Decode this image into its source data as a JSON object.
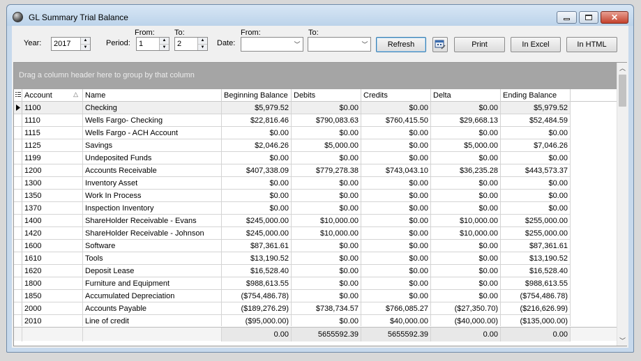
{
  "window": {
    "title": "GL Summary Trial Balance"
  },
  "toolbar": {
    "year_label": "Year:",
    "year_value": "2017",
    "period_label": "Period:",
    "period_from_label": "From:",
    "period_to_label": "To:",
    "period_from": "1",
    "period_to": "2",
    "date_label": "Date:",
    "date_from_label": "From:",
    "date_to_label": "To:",
    "date_from": "",
    "date_to": "",
    "refresh": "Refresh",
    "print": "Print",
    "in_excel": "In Excel",
    "in_html": "In HTML"
  },
  "grid": {
    "group_panel_text": "Drag a column header here to group by that column",
    "columns": [
      "Account",
      "Name",
      "Beginning Balance",
      "Debits",
      "Credits",
      "Delta",
      "Ending Balance"
    ],
    "rows": [
      [
        "1100",
        "Checking",
        "$5,979.52",
        "$0.00",
        "$0.00",
        "$0.00",
        "$5,979.52"
      ],
      [
        "1110",
        "Wells Fargo- Checking",
        "$22,816.46",
        "$790,083.63",
        "$760,415.50",
        "$29,668.13",
        "$52,484.59"
      ],
      [
        "1115",
        "Wells Fargo - ACH Account",
        "$0.00",
        "$0.00",
        "$0.00",
        "$0.00",
        "$0.00"
      ],
      [
        "1125",
        "Savings",
        "$2,046.26",
        "$5,000.00",
        "$0.00",
        "$5,000.00",
        "$7,046.26"
      ],
      [
        "1199",
        "Undeposited Funds",
        "$0.00",
        "$0.00",
        "$0.00",
        "$0.00",
        "$0.00"
      ],
      [
        "1200",
        "Accounts Receivable",
        "$407,338.09",
        "$779,278.38",
        "$743,043.10",
        "$36,235.28",
        "$443,573.37"
      ],
      [
        "1300",
        "Inventory Asset",
        "$0.00",
        "$0.00",
        "$0.00",
        "$0.00",
        "$0.00"
      ],
      [
        "1350",
        "Work In Process",
        "$0.00",
        "$0.00",
        "$0.00",
        "$0.00",
        "$0.00"
      ],
      [
        "1370",
        "Inspection Inventory",
        "$0.00",
        "$0.00",
        "$0.00",
        "$0.00",
        "$0.00"
      ],
      [
        "1400",
        "ShareHolder Receivable - Evans",
        "$245,000.00",
        "$10,000.00",
        "$0.00",
        "$10,000.00",
        "$255,000.00"
      ],
      [
        "1420",
        "ShareHolder Receivable - Johnson",
        "$245,000.00",
        "$10,000.00",
        "$0.00",
        "$10,000.00",
        "$255,000.00"
      ],
      [
        "1600",
        "Software",
        "$87,361.61",
        "$0.00",
        "$0.00",
        "$0.00",
        "$87,361.61"
      ],
      [
        "1610",
        "Tools",
        "$13,190.52",
        "$0.00",
        "$0.00",
        "$0.00",
        "$13,190.52"
      ],
      [
        "1620",
        "Deposit Lease",
        "$16,528.40",
        "$0.00",
        "$0.00",
        "$0.00",
        "$16,528.40"
      ],
      [
        "1800",
        "Furniture and  Equipment",
        "$988,613.55",
        "$0.00",
        "$0.00",
        "$0.00",
        "$988,613.55"
      ],
      [
        "1850",
        "Accumulated Depreciation",
        "($754,486.78)",
        "$0.00",
        "$0.00",
        "$0.00",
        "($754,486.78)"
      ],
      [
        "2000",
        "Accounts Payable",
        "($189,276.29)",
        "$738,734.57",
        "$766,085.27",
        "($27,350.70)",
        "($216,626.99)"
      ],
      [
        "2010",
        "Line of credit",
        "($95,000.00)",
        "$0.00",
        "$40,000.00",
        "($40,000.00)",
        "($135,000.00)"
      ]
    ],
    "totals": [
      "0.00",
      "5655592.39",
      "5655592.39",
      "0.00",
      "0.00"
    ]
  },
  "icons": {
    "app": "app-globe-icon",
    "calendar": "calendar-icon",
    "sort": "sort-ascending-icon",
    "row_indicator": "current-row-indicator-icon"
  }
}
